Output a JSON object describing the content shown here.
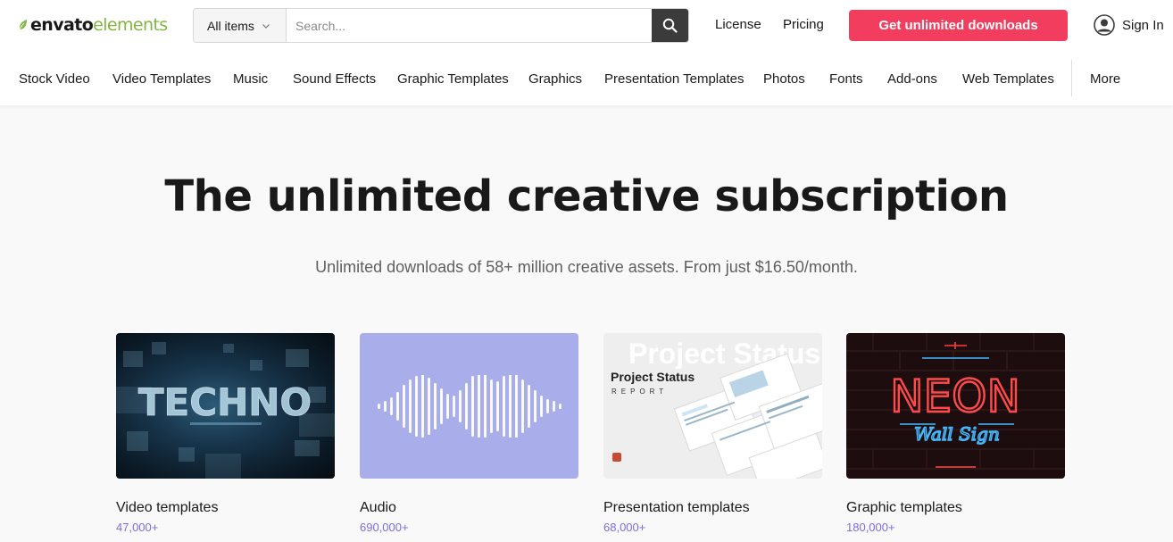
{
  "brand": {
    "name_bold": "envato",
    "name_light": "elements",
    "accent": "#82b541"
  },
  "search": {
    "category": "All items",
    "placeholder": "Search..."
  },
  "header_links": {
    "license": "License",
    "pricing": "Pricing",
    "cta": "Get unlimited downloads",
    "signin": "Sign In"
  },
  "nav": [
    "Stock Video",
    "Video Templates",
    "Music",
    "Sound Effects",
    "Graphic Templates",
    "Graphics",
    "Presentation Templates",
    "Photos",
    "Fonts",
    "Add-ons",
    "Web Templates",
    "More"
  ],
  "hero": {
    "title": "The unlimited creative subscription",
    "subtitle": "Unlimited downloads of 58+ million creative assets. From just $16.50/month."
  },
  "cards": [
    {
      "title": "Video templates",
      "count": "47,000+",
      "thumb_text": "TECHNO"
    },
    {
      "title": "Audio",
      "count": "690,000+"
    },
    {
      "title": "Presentation templates",
      "count": "68,000+",
      "thumb_text": "Project Status",
      "thumb_sub": "REPORT",
      "thumb_bg": "Project Status"
    },
    {
      "title": "Graphic templates",
      "count": "180,000+",
      "thumb_text": "NEON",
      "thumb_sub": "Wall Sign"
    }
  ],
  "colors": {
    "cta": "#f33d5f",
    "count": "#7b6ee0",
    "audio_bg": "#a9adea"
  }
}
